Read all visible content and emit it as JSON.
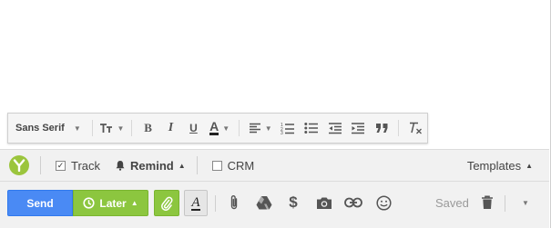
{
  "toolbar": {
    "font_family": "Sans Serif",
    "bold_glyph": "B",
    "italic_glyph": "I",
    "underline_glyph": "U",
    "text_color_glyph": "A"
  },
  "yesware": {
    "track_label": "Track",
    "track_checked": true,
    "remind_label": "Remind",
    "crm_label": "CRM",
    "crm_checked": false,
    "templates_label": "Templates",
    "brand_color": "#9bc53d"
  },
  "actions": {
    "send_label": "Send",
    "later_label": "Later",
    "saved_label": "Saved",
    "send_color": "#4a8af4",
    "later_color": "#8cc63f",
    "format_toggle_glyph": "A"
  },
  "icons": {
    "toolbar": [
      "chevron-down-icon",
      "text-size-icon",
      "bold-icon",
      "italic-icon",
      "underline-icon",
      "text-color-icon",
      "align-icon",
      "numbered-list-icon",
      "bulleted-list-icon",
      "indent-less-icon",
      "indent-more-icon",
      "quote-icon",
      "remove-formatting-icon"
    ],
    "actionbar": [
      "clock-icon",
      "paperclip-icon",
      "paperclip-icon",
      "drive-icon",
      "dollar-icon",
      "camera-icon",
      "link-icon",
      "emoji-icon",
      "trash-icon",
      "chevron-down-icon"
    ]
  }
}
